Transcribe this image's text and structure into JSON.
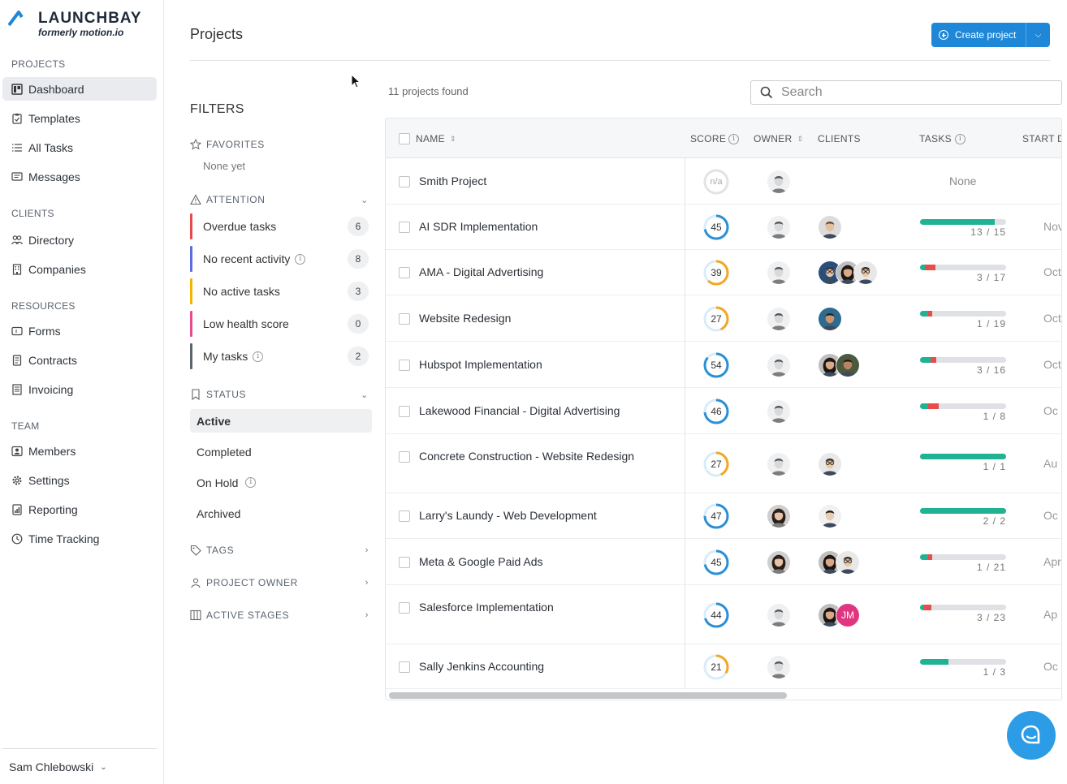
{
  "brand": {
    "name": "LAUNCHBAY",
    "subtitle": "formerly motion.io",
    "accent": "#1f87d8"
  },
  "sidebar": {
    "sections": [
      {
        "title": "PROJECTS",
        "items": [
          {
            "label": "Dashboard",
            "icon": "dashboard-icon",
            "active": true
          },
          {
            "label": "Templates",
            "icon": "clipboard-icon"
          },
          {
            "label": "All Tasks",
            "icon": "list-icon"
          },
          {
            "label": "Messages",
            "icon": "message-icon"
          }
        ]
      },
      {
        "title": "CLIENTS",
        "items": [
          {
            "label": "Directory",
            "icon": "people-icon"
          },
          {
            "label": "Companies",
            "icon": "building-icon"
          }
        ]
      },
      {
        "title": "RESOURCES",
        "items": [
          {
            "label": "Forms",
            "icon": "form-icon"
          },
          {
            "label": "Contracts",
            "icon": "document-icon"
          },
          {
            "label": "Invoicing",
            "icon": "invoice-icon"
          }
        ]
      },
      {
        "title": "TEAM",
        "items": [
          {
            "label": "Members",
            "icon": "member-icon"
          },
          {
            "label": "Settings",
            "icon": "gear-icon"
          },
          {
            "label": "Reporting",
            "icon": "report-icon"
          },
          {
            "label": "Time Tracking",
            "icon": "clock-icon"
          }
        ]
      }
    ],
    "user": "Sam Chlebowski"
  },
  "header": {
    "title": "Projects",
    "create_label": "Create project"
  },
  "filters": {
    "title": "FILTERS",
    "favorites": {
      "label": "FAVORITES",
      "empty": "None yet"
    },
    "attention": {
      "label": "ATTENTION",
      "items": [
        {
          "label": "Overdue tasks",
          "count": "6",
          "color": "#e8494b"
        },
        {
          "label": "No recent activity",
          "count": "8",
          "color": "#5b6ee1",
          "info": true
        },
        {
          "label": "No active tasks",
          "count": "3",
          "color": "#f4b400"
        },
        {
          "label": "Low health score",
          "count": "0",
          "color": "#e64c8c"
        },
        {
          "label": "My tasks",
          "count": "2",
          "color": "#5b6470",
          "info": true
        }
      ]
    },
    "status": {
      "label": "STATUS",
      "items": [
        {
          "label": "Active",
          "active": true
        },
        {
          "label": "Completed"
        },
        {
          "label": "On Hold",
          "info": true
        },
        {
          "label": "Archived"
        }
      ]
    },
    "tags": {
      "label": "TAGS"
    },
    "owner": {
      "label": "PROJECT OWNER"
    },
    "stages": {
      "label": "ACTIVE STAGES"
    }
  },
  "results": {
    "count_text": "11 projects found",
    "search_placeholder": "Search",
    "columns": {
      "name": "NAME",
      "score": "SCORE",
      "owner": "OWNER",
      "clients": "CLIENTS",
      "tasks": "TASKS",
      "start": "START D/"
    },
    "rows": [
      {
        "name": "Smith Project",
        "score": "n/a",
        "owner": "gray",
        "clients": [],
        "tasks_none": "None",
        "start": ""
      },
      {
        "name": "AI SDR Implementation",
        "score": "45",
        "owner": "gray",
        "clients": [
          "man1"
        ],
        "done": 13,
        "total": 15,
        "red": 0,
        "tasks": "13 / 15",
        "start": "Nov"
      },
      {
        "name": "AMA - Digital Advertising",
        "score": "39",
        "owner": "gray",
        "clients": [
          "man2",
          "woman1",
          "man3"
        ],
        "done": 1,
        "total": 17,
        "red": 2,
        "tasks": "3 / 17",
        "start": "Oct"
      },
      {
        "name": "Website Redesign",
        "score": "27",
        "owner": "gray",
        "clients": [
          "man4"
        ],
        "done": 0,
        "total": 19,
        "red": 1,
        "tasks": "1 / 19",
        "start": "Oct"
      },
      {
        "name": "Hubspot Implementation",
        "score": "54",
        "owner": "gray",
        "clients": [
          "woman1",
          "man5"
        ],
        "done": 2,
        "total": 16,
        "red": 1,
        "tasks": "3 / 16",
        "start": "Oct"
      },
      {
        "name": "Lakewood Financial - Digital Advertising",
        "score": "46",
        "owner": "gray",
        "clients": [],
        "done": 0,
        "total": 8,
        "red": 1,
        "tasks": "1 / 8",
        "start": "Oc"
      },
      {
        "name": "Concrete Construction - Website Redesign",
        "score": "27",
        "owner": "gray",
        "clients": [
          "man3"
        ],
        "done": 1,
        "total": 1,
        "red": 0,
        "tasks": "1 / 1",
        "start": "Au"
      },
      {
        "name": "Larry's Laundy - Web Development",
        "score": "47",
        "owner": "woman2",
        "clients": [
          "man6"
        ],
        "done": 2,
        "total": 2,
        "red": 0,
        "tasks": "2 / 2",
        "start": "Oc"
      },
      {
        "name": "Meta & Google Paid Ads",
        "score": "45",
        "owner": "woman2",
        "clients": [
          "woman1",
          "man3"
        ],
        "done": 0,
        "total": 21,
        "red": 1,
        "tasks": "1 / 21",
        "start": "Apr"
      },
      {
        "name": "Salesforce Implementation",
        "score": "44",
        "owner": "gray",
        "clients": [
          "woman1",
          "JM"
        ],
        "done": 1,
        "total": 23,
        "red": 2,
        "tasks": "3 / 23",
        "start": "Ap"
      },
      {
        "name": "Sally Jenkins Accounting",
        "score": "21",
        "owner": "gray",
        "clients": [],
        "done": 1,
        "total": 3,
        "red": 0,
        "tasks": "1 / 3",
        "start": "Oc"
      }
    ]
  }
}
